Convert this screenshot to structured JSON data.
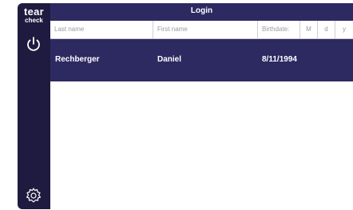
{
  "sidebar": {
    "logo_line1": "tear",
    "logo_line2": "check",
    "power_icon": "power-icon",
    "settings_icon": "gear-icon"
  },
  "header": {
    "title": "Login"
  },
  "columns": {
    "last_name": "Last name",
    "first_name": "First name",
    "birthdate": "Birthdate:",
    "m": "M",
    "d": "d",
    "y": "y"
  },
  "row": {
    "last_name": "Rechberger",
    "first_name": "Daniel",
    "birthdate": "8/11/1994"
  },
  "colors": {
    "dark": "#1f1a3f",
    "accent": "#2d2a62"
  }
}
